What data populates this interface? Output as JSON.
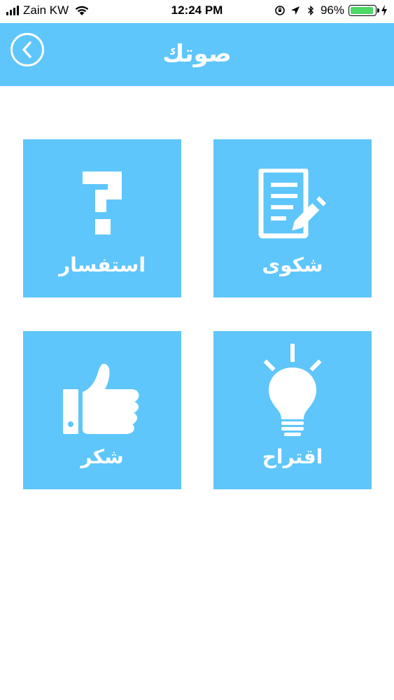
{
  "status_bar": {
    "carrier": "Zain KW",
    "time": "12:24 PM",
    "battery_percent": "96%",
    "battery_level": 0.96
  },
  "header": {
    "title": "صوتك",
    "back_icon": "chevron-left-icon"
  },
  "tiles": [
    {
      "id": "complaint",
      "label": "شكوى",
      "icon": "document-pencil-icon"
    },
    {
      "id": "inquiry",
      "label": "استفسار",
      "icon": "question-mark-icon"
    },
    {
      "id": "suggestion",
      "label": "اقتراح",
      "icon": "lightbulb-icon"
    },
    {
      "id": "thanks",
      "label": "شكر",
      "icon": "thumbs-up-icon"
    }
  ],
  "colors": {
    "accent": "#5ec6fb",
    "text_on_accent": "#ffffff",
    "background": "#ffffff",
    "battery": "#4cd964"
  }
}
